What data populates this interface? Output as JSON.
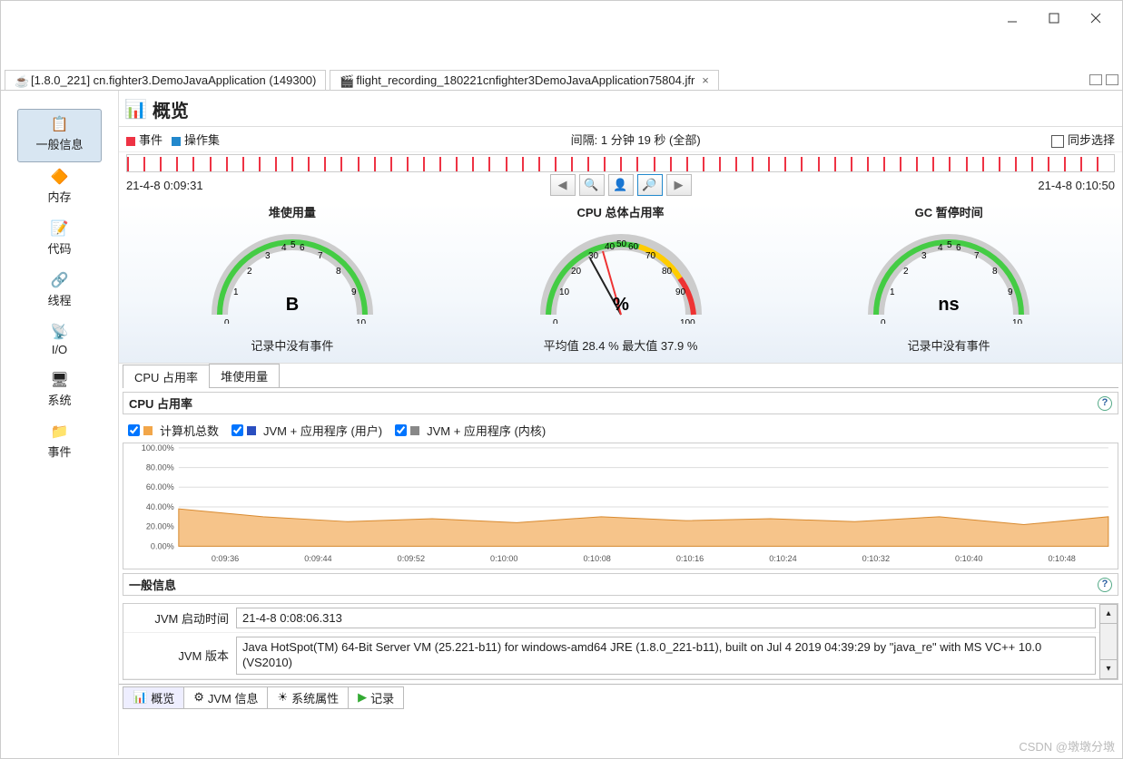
{
  "window": {
    "minimize": "—",
    "maximize": "☐",
    "close": "✕"
  },
  "tabs": {
    "main": "[1.8.0_221] cn.fighter3.DemoJavaApplication (149300)",
    "recording": "flight_recording_180221cnfighter3DemoJavaApplication75804.jfr",
    "close_x": "×"
  },
  "sidebar": {
    "items": [
      {
        "label": "一般信息",
        "icon": "📋"
      },
      {
        "label": "内存",
        "icon": "🔶"
      },
      {
        "label": "代码",
        "icon": "📝"
      },
      {
        "label": "线程",
        "icon": "🔗"
      },
      {
        "label": "I/O",
        "icon": "📡"
      },
      {
        "label": "系统",
        "icon": "🖥"
      },
      {
        "label": "事件",
        "icon": "📁"
      }
    ]
  },
  "page": {
    "title": "概览",
    "legend_event": "事件",
    "legend_ops": "操作集",
    "interval": "间隔: 1 分钟 19 秒 (全部)",
    "sync_label": "同步选择",
    "time_start": "21-4-8 0:09:31",
    "time_end": "21-4-8 0:10:50"
  },
  "gauges": {
    "heap": {
      "title": "堆使用量",
      "unit": "B",
      "caption": "记录中没有事件"
    },
    "cpu": {
      "title": "CPU 总体占用率",
      "unit": "%",
      "caption": "平均值 28.4 %   最大值 37.9 %"
    },
    "gc": {
      "title": "GC 暂停时间",
      "unit": "ns",
      "caption": "记录中没有事件"
    }
  },
  "mini_tabs": {
    "cpu": "CPU 占用率",
    "heap": "堆使用量"
  },
  "chart": {
    "title": "CPU 占用率",
    "legend": {
      "total": "计算机总数",
      "jvm_user": "JVM + 应用程序 (用户)",
      "jvm_kernel": "JVM + 应用程序 (内核)"
    },
    "ylabels": [
      "100.00%",
      "80.00%",
      "60.00%",
      "40.00%",
      "20.00%",
      "0.00%"
    ],
    "xlabels": [
      "0:09:36",
      "0:09:44",
      "0:09:52",
      "0:10:00",
      "0:10:08",
      "0:10:16",
      "0:10:24",
      "0:10:32",
      "0:10:40",
      "0:10:48"
    ]
  },
  "chart_data": {
    "type": "area",
    "title": "CPU 占用率",
    "xlabel": "",
    "ylabel": "%",
    "ylim": [
      0,
      100
    ],
    "x": [
      "0:09:31",
      "0:09:36",
      "0:09:44",
      "0:09:52",
      "0:10:00",
      "0:10:08",
      "0:10:16",
      "0:10:24",
      "0:10:32",
      "0:10:40",
      "0:10:48",
      "0:10:50"
    ],
    "series": [
      {
        "name": "计算机总数",
        "color": "#f2a649",
        "values": [
          38,
          30,
          25,
          28,
          24,
          30,
          26,
          28,
          25,
          30,
          22,
          30
        ]
      },
      {
        "name": "JVM + 应用程序 (用户)",
        "color": "#2a4fc0",
        "values": []
      },
      {
        "name": "JVM + 应用程序 (内核)",
        "color": "#888",
        "values": []
      }
    ]
  },
  "general": {
    "title": "一般信息",
    "rows": {
      "jvm_start_label": "JVM 启动时间",
      "jvm_start_value": "21-4-8 0:08:06.313",
      "jvm_version_label": "JVM 版本",
      "jvm_version_value": "Java HotSpot(TM) 64-Bit Server VM (25.221-b11) for windows-amd64 JRE (1.8.0_221-b11), built on Jul  4 2019 04:39:29 by \"java_re\" with MS VC++ 10.0 (VS2010)"
    }
  },
  "bottom_tabs": {
    "overview": "概览",
    "jvm_info": "JVM 信息",
    "sys_props": "系统属性",
    "record": "记录"
  },
  "watermark": "CSDN @墩墩分墩"
}
